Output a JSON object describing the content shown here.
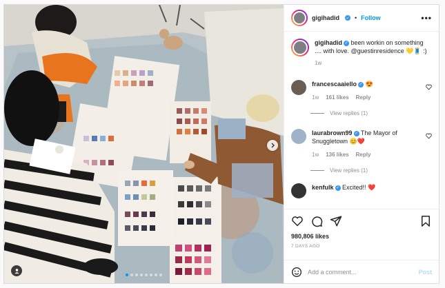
{
  "post": {
    "author": "gigihadid",
    "follow_label": "Follow",
    "more_label": "•••",
    "caption_text": "been workin on something .... with love. @guestinresidence 💛🧵 :)",
    "caption_age": "1w",
    "photo_count": 8,
    "active_photo": 1
  },
  "comments": [
    {
      "user": "francescaaiello",
      "text": "😍",
      "age": "1w",
      "likes": "161 likes",
      "reply_label": "Reply",
      "view_replies": "View replies (1)"
    },
    {
      "user": "laurabrown99",
      "text": "The Mayor of Snuggletown 😊❤️",
      "age": "1w",
      "likes": "136 likes",
      "reply_label": "Reply",
      "view_replies": "View replies (1)"
    },
    {
      "user": "kenfulk",
      "text": "Excited!! ❤️"
    }
  ],
  "footer": {
    "likes": "980,806 likes",
    "date": "7 DAYS AGO",
    "add_comment_placeholder": "Add a comment...",
    "post_label": "Post"
  },
  "colors": {
    "accent": "#0095f6",
    "verified": "#3897f0",
    "muted": "#8e8e8e"
  },
  "icons": {
    "like": "heart-icon",
    "comment": "comment-icon",
    "share": "paper-plane-icon",
    "save": "bookmark-icon",
    "emoji": "smiley-icon"
  }
}
